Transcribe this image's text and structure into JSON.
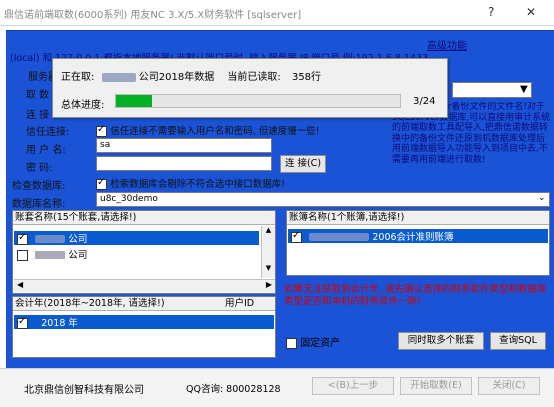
{
  "window": {
    "title": "鼎信诺前端取数(6000系列)  用友NC 3.X/5.X财务软件 [sqlserver]",
    "help_glyph": "?",
    "close_glyph": "✕"
  },
  "form": {
    "note": "(local) 和 127.0.0.1 都指本地服务器! 非默认端口号时, 输入服务器 IP,端口号 例:192.1.6.8,1433",
    "advanced_link": "高级功能",
    "server_label": "服务器",
    "fetch_label": "取 数",
    "connect_label": "连 接",
    "trusted_label": "信任连接:",
    "trusted_text": "信任连接不需要输入用户名和密码, 但速度慢一些!",
    "trusted_checked": true,
    "username_label": "用 户 名:",
    "username_value": "sa",
    "password_label": "密    码:",
    "password_value": "",
    "connect_button": "连 接(C)",
    "checkdb_label": "检查数据库:",
    "checkdb_text": "检索数据库会剔除不符合选中接口数据库!",
    "checkdb_checked": true,
    "dbname_label": "数据库名称:",
    "dbname_value": "u8c_30demo",
    "side_note": "来的sqlserver备份文件的文件名!对于SQLServer数据库,可以直接用审计系统的前端取数工具配导入,把鼎信诺数据转换中的备份文件还原到机数据库处理后用前端数据导入功能导入到项目中去,不需要再用前端进行取数!"
  },
  "accounts": {
    "header": "账套名称(15个账套,请选择!)",
    "items": [
      {
        "label": "公司",
        "checked": true,
        "selected": true
      },
      {
        "label": "公司",
        "checked": false,
        "selected": false
      }
    ]
  },
  "books": {
    "header": "账簿名称(1个账簿,请选择!)",
    "items": [
      {
        "label": "2006会计准则账簿",
        "checked": true,
        "selected": true
      }
    ]
  },
  "years": {
    "header_year": "会计年(2018年~2018年, 请选择!)",
    "header_user": "用户ID",
    "items": [
      {
        "label": "2018 年",
        "checked": true,
        "selected": true
      }
    ]
  },
  "warning": "如果无法获取到会计年, 请先确认选择的财务软件类型和数据库类型是否和本机的财务软件一致!",
  "fixed_assets_label": "固定资产",
  "fixed_assets_checked": false,
  "multi_button": "同时取多个账套",
  "query_button": "查询SQL",
  "status": {
    "company": "北京鼎信创智科技有限公司",
    "qq": "QQ咨询: 800028128",
    "prev_button": "<(B)上一步",
    "start_button": "开始取数(E)",
    "close_button": "关闭(C)"
  },
  "progress_dialog": {
    "fetching_prefix": "正在取:",
    "fetching_company": "公司2018年数据",
    "read_label": "当前已读取:",
    "read_value": "358行",
    "overall_label": "总体进度:",
    "counter": "3/24",
    "progress_fraction": 0.125
  }
}
